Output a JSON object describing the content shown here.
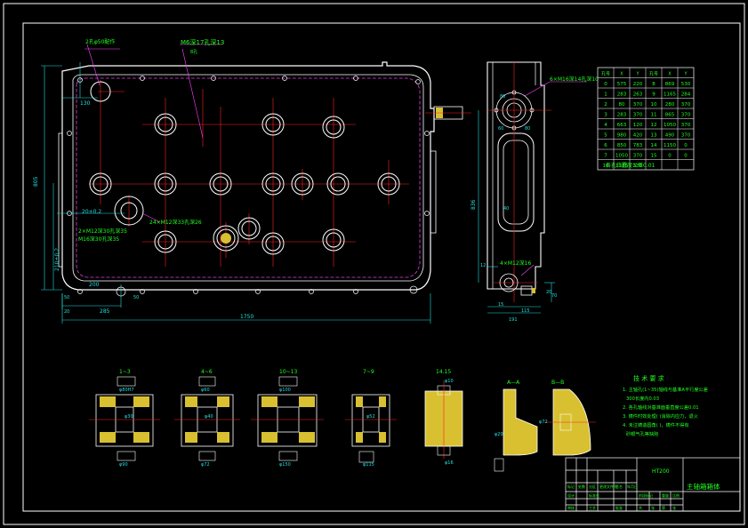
{
  "drawing": {
    "title_block": {
      "part_name": "主轴箱箱体",
      "model_code": "HT200",
      "row_cells": [
        "标记",
        "处数",
        "分区",
        "更改文件号",
        "签名",
        "年月日"
      ],
      "row_cells_2": [
        "设计",
        "标准化",
        "阶段标记",
        "重量",
        "比例"
      ],
      "row_cells_3": [
        "审核",
        "工艺",
        "批准",
        "共",
        "张",
        "第",
        "张"
      ]
    },
    "dimensions": {
      "overall_length": "1750",
      "overall_height": "805",
      "left_offset_1": "130",
      "bottom_offset_1": "200",
      "bottom_offset_2": "285",
      "bottom_offset_3": "50",
      "left_small_1": "50",
      "left_small_2": "20",
      "left_vert_1": "20±0.2",
      "left_vert_2": "210±0.2",
      "side_height": "836",
      "side_width_1": "40",
      "side_bottom_1": "15",
      "side_bottom_2": "115",
      "side_bottom_3": "191",
      "side_right_1": "20",
      "side_right_2": "70",
      "side_top_1": "80",
      "side_top_2": "60",
      "side_top_3": "80",
      "side_left_1": "12"
    },
    "notes_leaders": {
      "top_callout_1": "2孔φ50配作",
      "top_callout_2": "M6深17孔深13",
      "top_callout_2b": "8孔",
      "hole_callout_1": "2×M12深30孔深35",
      "hole_callout_2": "M16深30孔深35",
      "center_callout": "24×M12深33孔深26",
      "side_top_callout": "6×M16深14孔深10",
      "side_bottom_callout": "4×M12深16",
      "flatness_note": "各孔位置度公差0.01"
    },
    "coord_table": {
      "headers": [
        "孔号",
        "X",
        "Y",
        "孔号",
        "X",
        "Y"
      ],
      "rows": [
        [
          "0",
          "575",
          "220",
          "8",
          "869",
          "530"
        ],
        [
          "1",
          "283",
          "263",
          "9",
          "1165",
          "284"
        ],
        [
          "2",
          "80",
          "370",
          "10",
          "280",
          "370"
        ],
        [
          "3",
          "283",
          "370",
          "11",
          "865",
          "370"
        ],
        [
          "4",
          "663",
          "120",
          "12",
          "1050",
          "370"
        ],
        [
          "5",
          "980",
          "420",
          "13",
          "490",
          "370"
        ],
        [
          "6",
          "850",
          "783",
          "14",
          "1150",
          "0"
        ],
        [
          "7",
          "1050",
          "370",
          "15",
          "0",
          "0"
        ],
        [
          "16",
          "1385",
          "370",
          "",
          "",
          ""
        ]
      ]
    },
    "section_views": {
      "labels": [
        "1~3",
        "4~6",
        "10~13",
        "7~9",
        "14.15",
        "A—A",
        "B—B"
      ],
      "dims": [
        "φ80H7",
        "φ90",
        "φ60",
        "φ72",
        "φ100",
        "φ115",
        "φ150",
        "φ52",
        "φ30",
        "φ16",
        "φ10",
        "φ20",
        "φ40",
        "φ72"
      ]
    },
    "tech_requirements": {
      "title": "技 术 要 求",
      "items": [
        "1. 主轴孔(1~35)轴线与基准A平行度公差",
        "300长度内0.03",
        "2. 各孔轴线对基准面垂直度公差0.01",
        "3. 铸件时效处理(  )消除内应力，退火",
        "4. 未注铸造圆角(  )，铸件不得有",
        "砂眼气孔等缺陷"
      ]
    }
  },
  "colors": {
    "background": "#000000",
    "border": "#ffffff",
    "outline": "#ffffff",
    "centerline": "#ff2020",
    "hidden": "#e040e0",
    "dimension": "#20e0e0",
    "annotation": "#20ff20",
    "section_fill": "#d8c030",
    "leader": "#ff40ff"
  }
}
